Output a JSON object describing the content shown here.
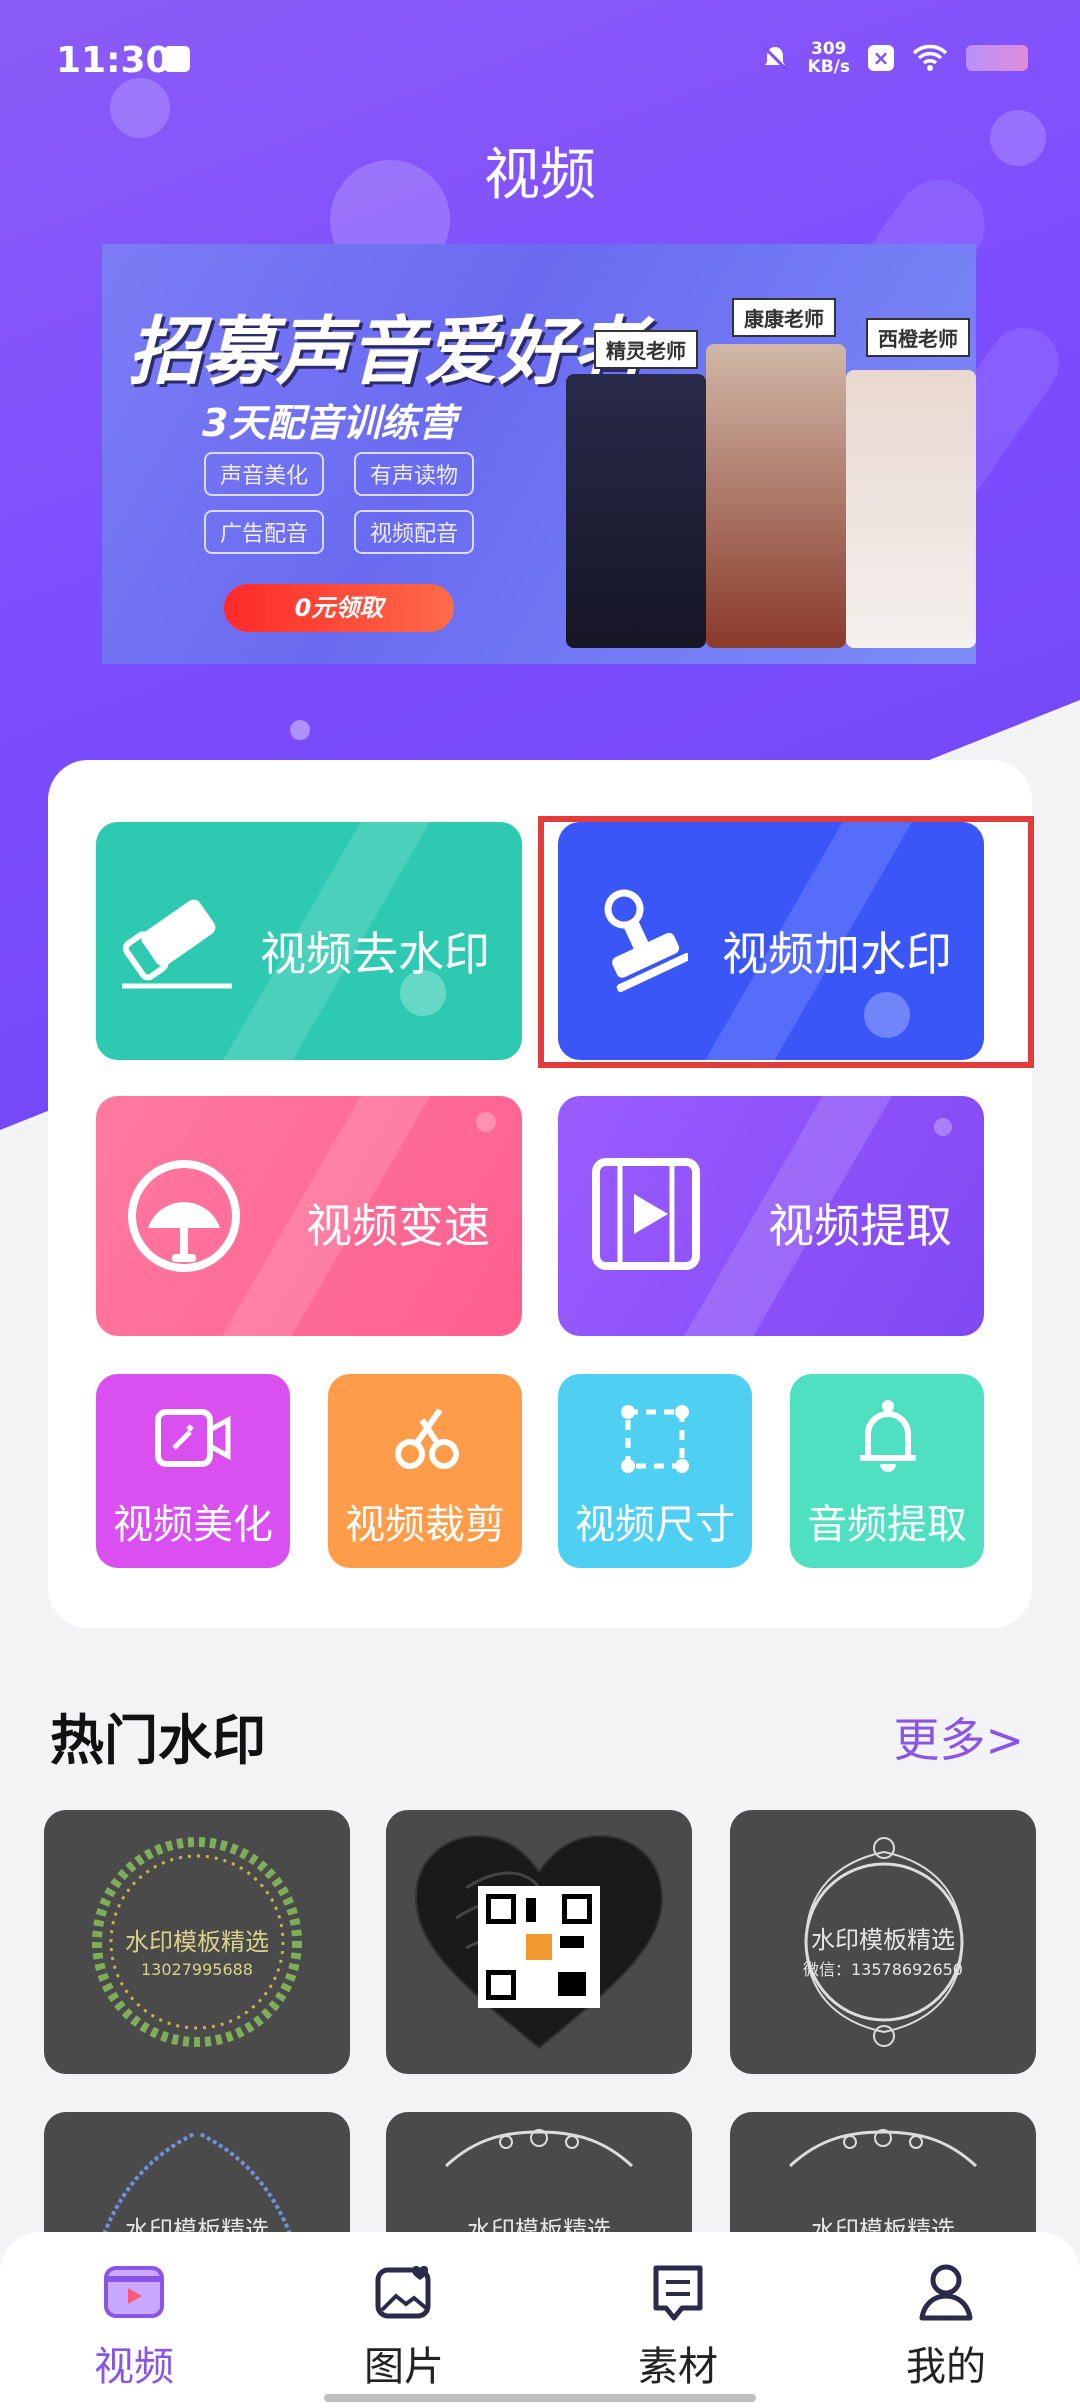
{
  "status_bar": {
    "time": "11:30",
    "net_speed_value": "309",
    "net_speed_unit": "KB/s"
  },
  "header": {
    "title": "视频"
  },
  "banner": {
    "headline": "招募声音爱好者",
    "subtitle": "3天配音训练营",
    "tags": [
      "声音美化",
      "有声读物",
      "广告配音",
      "视频配音"
    ],
    "cta": "0元领取",
    "teachers": [
      "精灵老师",
      "康康老师",
      "西橙老师"
    ]
  },
  "tools": {
    "big": [
      {
        "label": "视频去水印",
        "icon": "eraser-icon",
        "color": "#2ec9b1"
      },
      {
        "label": "视频加水印",
        "icon": "stamp-icon",
        "color": "#3a56f7"
      },
      {
        "label": "视频变速",
        "icon": "speedometer-icon",
        "color": "#ff6f94"
      },
      {
        "label": "视频提取",
        "icon": "video-play-icon",
        "color": "#8b55f5"
      }
    ],
    "small": [
      {
        "label": "视频美化",
        "icon": "video-camera-magic-icon",
        "color": "#d94ff0"
      },
      {
        "label": "视频裁剪",
        "icon": "scissors-icon",
        "color": "#ff9c4a"
      },
      {
        "label": "视频尺寸",
        "icon": "resize-frame-icon",
        "color": "#4fd0f3"
      },
      {
        "label": "音频提取",
        "icon": "bell-icon",
        "color": "#4fe0c2"
      }
    ]
  },
  "hot_watermarks": {
    "title": "热门水印",
    "more": "更多>",
    "items": [
      {
        "text": "水印模板精选",
        "sub": "13027995688"
      },
      {
        "text": "",
        "sub": ""
      },
      {
        "text": "水印模板精选",
        "sub": "微信：13578692650"
      },
      {
        "text": "水印模板精选",
        "sub": ""
      },
      {
        "text": "水印模板精选",
        "sub": ""
      },
      {
        "text": "水印模板精选",
        "sub": ""
      }
    ]
  },
  "tabbar": {
    "items": [
      {
        "label": "视频",
        "icon": "video-tab-icon",
        "active": true
      },
      {
        "label": "图片",
        "icon": "image-tab-icon",
        "active": false
      },
      {
        "label": "素材",
        "icon": "material-tab-icon",
        "active": false
      },
      {
        "label": "我的",
        "icon": "profile-tab-icon",
        "active": false
      }
    ]
  },
  "colors": {
    "accent": "#8a55e6",
    "highlight_border": "#e33a3a"
  }
}
